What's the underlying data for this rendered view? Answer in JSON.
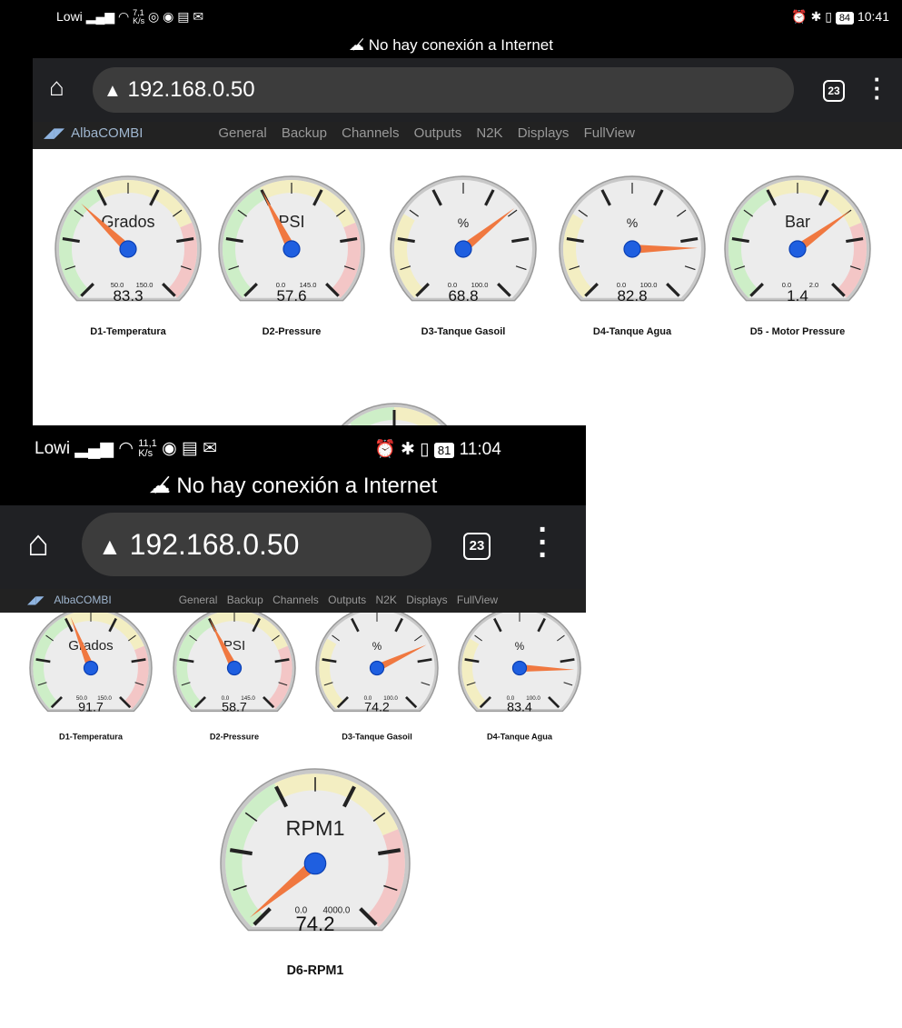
{
  "screenshot_a": {
    "status": {
      "carrier": "Lowi",
      "speed_value": "7,1",
      "speed_unit": "K/s",
      "battery": "84",
      "time": "10:41"
    },
    "offline_message": "No hay conexión a Internet",
    "url": "192.168.0.50",
    "tab_count": "23",
    "brand": "AlbaCOMBI",
    "nav": [
      "General",
      "Backup",
      "Channels",
      "Outputs",
      "N2K",
      "Displays",
      "FullView"
    ],
    "gauges": [
      {
        "title": "D1-Temperatura",
        "unit": "Grados",
        "min": "50.0",
        "max": "150.0",
        "value": "83.3",
        "needle_fraction": 0.33,
        "zones": [
          [
            "#cdeec7",
            0,
            0.4
          ],
          [
            "#f3eec2",
            0.4,
            0.75
          ],
          [
            "#f3c6c6",
            0.75,
            1
          ]
        ]
      },
      {
        "title": "D2-Pressure",
        "unit": "PSI",
        "min": "0.0",
        "max": "145.0",
        "value": "57.6",
        "needle_fraction": 0.4,
        "zones": [
          [
            "#cdeec7",
            0,
            0.4
          ],
          [
            "#f3eec2",
            0.4,
            0.75
          ],
          [
            "#f3c6c6",
            0.75,
            1
          ]
        ]
      },
      {
        "title": "D3-Tanque Gasoil",
        "unit": "%",
        "min": "0.0",
        "max": "100.0",
        "value": "68.8",
        "needle_fraction": 0.69,
        "zones": [
          [
            "#f3eec2",
            0,
            0.28
          ]
        ]
      },
      {
        "title": "D4-Tanque Agua",
        "unit": "%",
        "min": "0.0",
        "max": "100.0",
        "value": "82.8",
        "needle_fraction": 0.83,
        "zones": [
          [
            "#f3eec2",
            0,
            0.28
          ]
        ]
      },
      {
        "title": "D5 - Motor Pressure",
        "unit": "Bar",
        "min": "0.0",
        "max": "2.0",
        "value": "1.4",
        "needle_fraction": 0.7,
        "zones": [
          [
            "#cdeec7",
            0,
            0.4
          ],
          [
            "#f3eec2",
            0.4,
            0.75
          ],
          [
            "#f3c6c6",
            0.75,
            1
          ]
        ]
      }
    ]
  },
  "screenshot_b": {
    "status": {
      "carrier": "Lowi",
      "speed_value": "11,1",
      "speed_unit": "K/s",
      "battery": "81",
      "time": "11:04"
    },
    "offline_message": "No hay conexión a Internet",
    "url": "192.168.0.50",
    "tab_count": "23",
    "brand": "AlbaCOMBI",
    "nav": [
      "General",
      "Backup",
      "Channels",
      "Outputs",
      "N2K",
      "Displays",
      "FullView"
    ],
    "gauges": [
      {
        "title": "D1-Temperatura",
        "unit": "Grados",
        "min": "50.0",
        "max": "150.0",
        "value": "91.7",
        "needle_fraction": 0.42,
        "zones": [
          [
            "#cdeec7",
            0,
            0.4
          ],
          [
            "#f3eec2",
            0.4,
            0.75
          ],
          [
            "#f3c6c6",
            0.75,
            1
          ]
        ]
      },
      {
        "title": "D2-Pressure",
        "unit": "PSI",
        "min": "0.0",
        "max": "145.0",
        "value": "58.7",
        "needle_fraction": 0.4,
        "zones": [
          [
            "#cdeec7",
            0,
            0.4
          ],
          [
            "#f3eec2",
            0.4,
            0.75
          ],
          [
            "#f3c6c6",
            0.75,
            1
          ]
        ]
      },
      {
        "title": "D3-Tanque Gasoil",
        "unit": "%",
        "min": "0.0",
        "max": "100.0",
        "value": "74.2",
        "needle_fraction": 0.74,
        "zones": [
          [
            "#f3eec2",
            0,
            0.28
          ]
        ]
      },
      {
        "title": "D4-Tanque Agua",
        "unit": "%",
        "min": "0.0",
        "max": "100.0",
        "value": "83.4",
        "needle_fraction": 0.84,
        "zones": [
          [
            "#f3eec2",
            0,
            0.28
          ]
        ]
      }
    ],
    "rpm_gauge": {
      "title": "D6-RPM1",
      "unit": "RPM1",
      "min": "0.0",
      "max": "4000.0",
      "value": "74.2",
      "needle_fraction": 0.02,
      "zones": [
        [
          "#cdeec7",
          0,
          0.4
        ],
        [
          "#f3eec2",
          0.4,
          0.75
        ],
        [
          "#f3c6c6",
          0.75,
          1
        ]
      ]
    }
  },
  "colors": {
    "accent": "#1f5fe0",
    "needle": "#f07840",
    "status_bar": "#000000",
    "url_bar": "#202124",
    "nav_bar": "#222222"
  },
  "icons": {
    "home": "home-icon",
    "warning": "warning-icon",
    "cloud_off": "cloud-off-icon",
    "menu": "more-vert-icon",
    "logo": "albacombi-logo"
  }
}
